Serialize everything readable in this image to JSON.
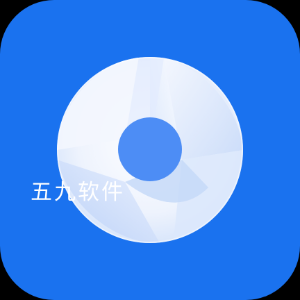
{
  "app_icon": {
    "icon_name": "browser-aperture-logo",
    "background_color": "#1a72ef",
    "disc_color": "#e9f0fc",
    "center_color": "#4d8df5",
    "watermark_text": "五九软件"
  }
}
